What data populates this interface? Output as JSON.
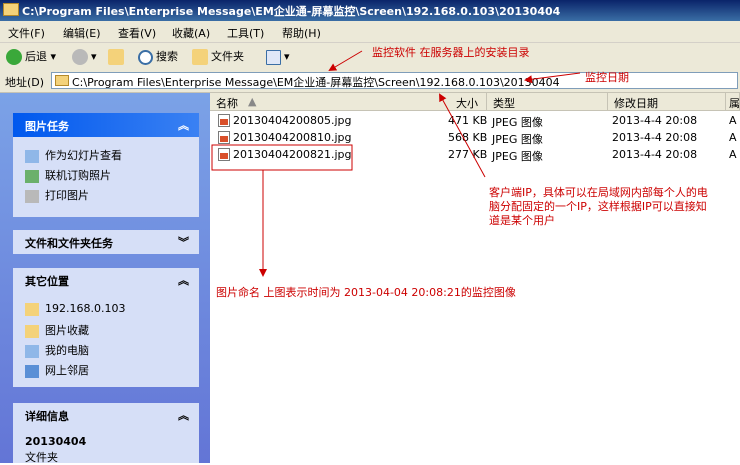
{
  "window": {
    "title": "C:\\Program Files\\Enterprise Message\\EM企业通-屏幕监控\\Screen\\192.168.0.103\\20130404"
  },
  "menu": [
    "文件(F)",
    "编辑(E)",
    "查看(V)",
    "收藏(A)",
    "工具(T)",
    "帮助(H)"
  ],
  "toolbar": {
    "back": "后退",
    "search": "搜索",
    "folders": "文件夹"
  },
  "address": {
    "label": "地址(D)",
    "value": "C:\\Program Files\\Enterprise Message\\EM企业通-屏幕监控\\Screen\\192.168.0.103\\20130404"
  },
  "left": {
    "picture_tasks": {
      "title": "图片任务",
      "items": [
        "作为幻灯片查看",
        "联机订购照片",
        "打印图片"
      ]
    },
    "file_tasks": {
      "title": "文件和文件夹任务"
    },
    "other_places": {
      "title": "其它位置",
      "items": [
        "192.168.0.103",
        "图片收藏",
        "我的电脑",
        "网上邻居"
      ]
    },
    "details": {
      "title": "详细信息",
      "name": "20130404",
      "type": "文件夹"
    }
  },
  "columns": {
    "name": "名称",
    "size": "大小",
    "type": "类型",
    "modified": "修改日期",
    "attr": "属"
  },
  "files": [
    {
      "name": "20130404200805.jpg",
      "size": "471 KB",
      "type": "JPEG 图像",
      "modified": "2013-4-4 20:08"
    },
    {
      "name": "20130404200810.jpg",
      "size": "568 KB",
      "type": "JPEG 图像",
      "modified": "2013-4-4 20:08"
    },
    {
      "name": "20130404200821.jpg",
      "size": "277 KB",
      "type": "JPEG 图像",
      "modified": "2013-4-4 20:08"
    }
  ],
  "annotations": {
    "install_dir": "监控软件 在服务器上的安装目录",
    "date": "监控日期",
    "client_ip_1": "客户端IP，具体可以在局域网内部每个人的电",
    "client_ip_2": "脑分配固定的一个IP，这样根据IP可以直接知",
    "client_ip_3": "道是某个用户",
    "naming": "图片命名 上图表示时间为 2013-04-04 20:08:21的监控图像"
  },
  "colors": {
    "annotation": "#cc0000",
    "title_bar": "#0a246a",
    "task_pane": "#6375d6"
  }
}
